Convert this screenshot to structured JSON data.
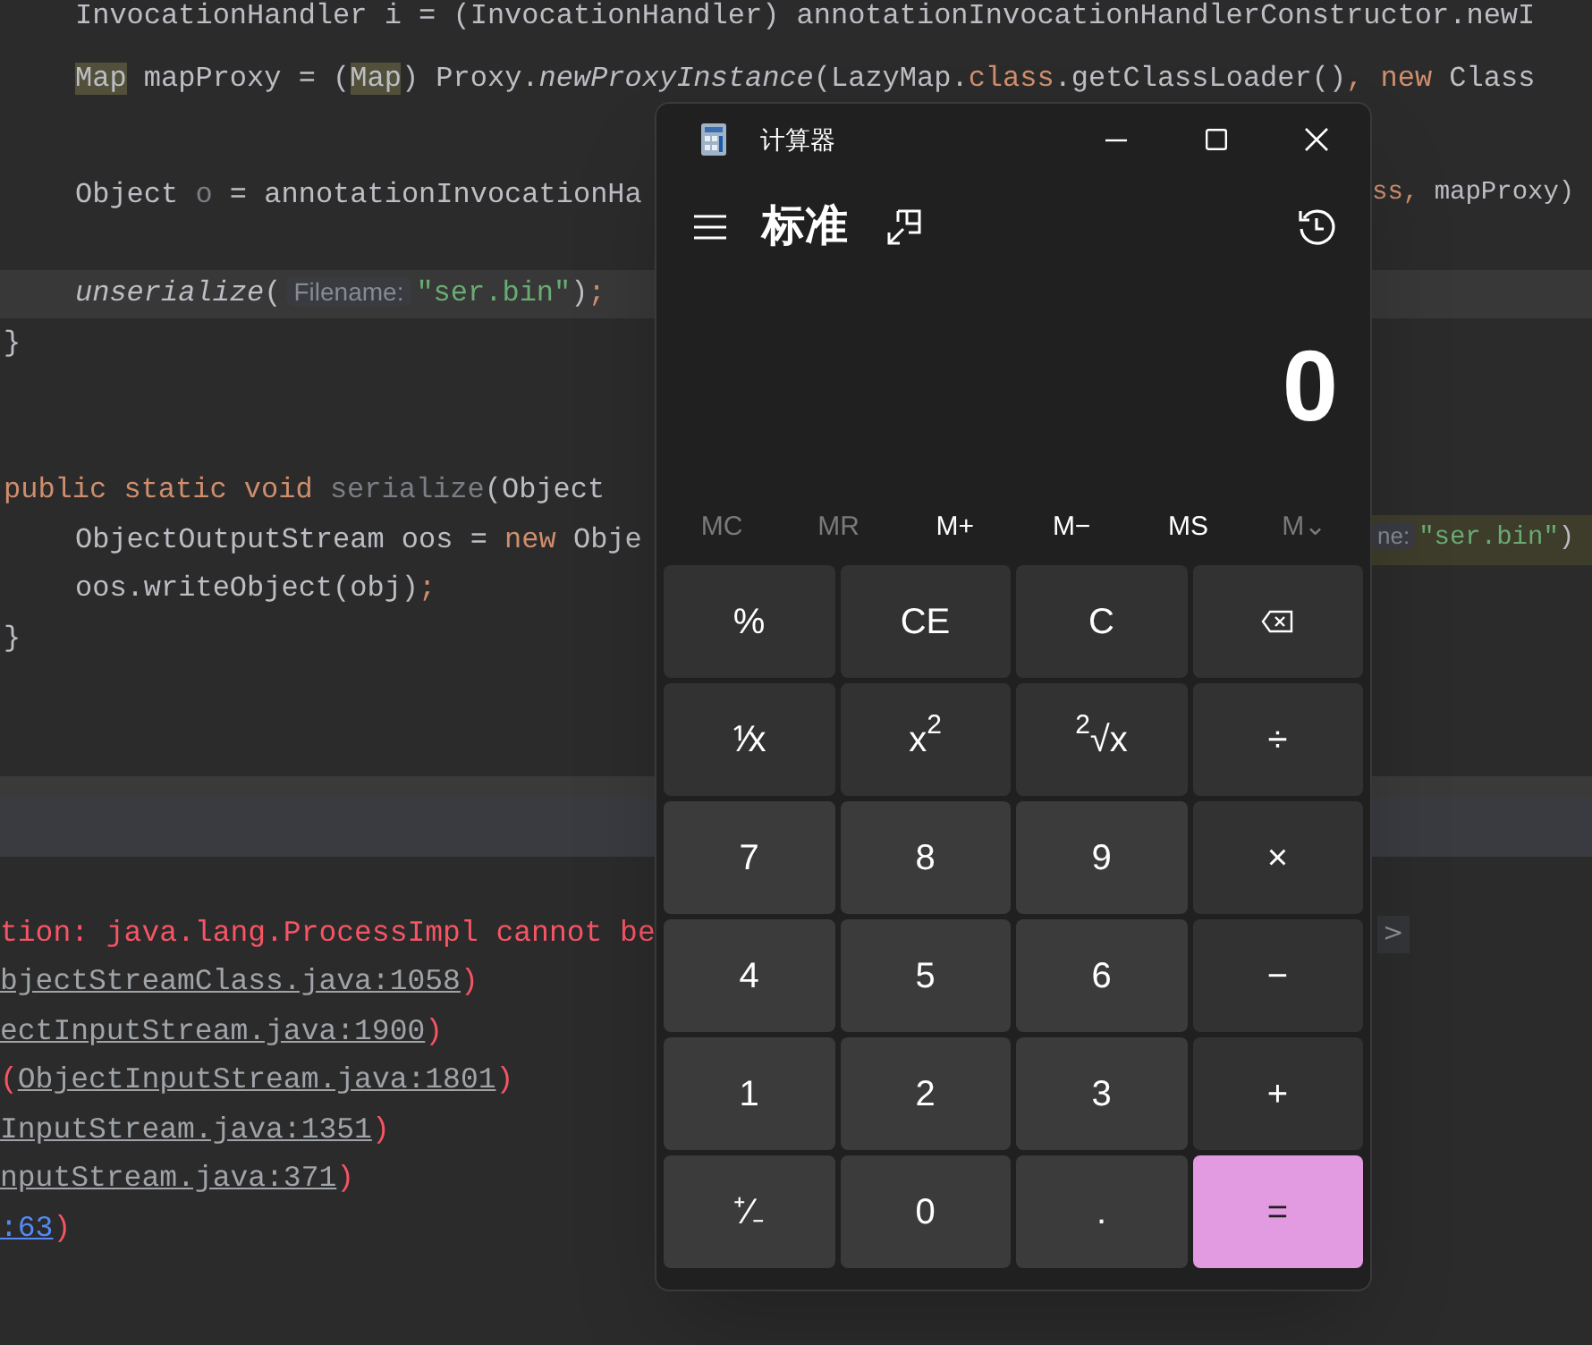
{
  "editor": {
    "lines": [
      {
        "kind": "indented",
        "current": false,
        "left": [
          {
            "text": "InvocationHandler i = (InvocationHandler) annotationInvocationHandlerConstructor.newI",
            "kind": "plain"
          }
        ]
      },
      {
        "kind": "blank",
        "current": false
      },
      {
        "kind": "indented",
        "current": false,
        "left": [
          {
            "text": "Map",
            "kind": "mark"
          },
          {
            "text": " mapProxy = (",
            "kind": "plain"
          },
          {
            "text": "Map",
            "kind": "mark"
          },
          {
            "text": ") Proxy.",
            "kind": "plain"
          },
          {
            "text": "newProxyInstance",
            "kind": "italic"
          },
          {
            "text": "(LazyMap.",
            "kind": "plain"
          },
          {
            "text": "class",
            "kind": "keyword"
          },
          {
            "text": ".getClassLoader()",
            "kind": "plain"
          },
          {
            "text": ", ",
            "kind": "keyword"
          },
          {
            "text": "new",
            "kind": "keyword"
          },
          {
            "text": " Class",
            "kind": "plain"
          }
        ]
      },
      {
        "kind": "blank",
        "current": false
      },
      {
        "kind": "indented",
        "current": false,
        "left": [
          {
            "text": "Object ",
            "kind": "plain"
          },
          {
            "text": "o",
            "kind": "unused"
          },
          {
            "text": " = annotationInvocationHa",
            "kind": "plain"
          }
        ],
        "right": [
          {
            "text": "ss",
            "kind": "keyword"
          },
          {
            "text": ", ",
            "kind": "keyword"
          },
          {
            "text": "mapProxy)",
            "kind": "plain"
          }
        ]
      },
      {
        "kind": "blank",
        "current": false
      },
      {
        "kind": "indented",
        "current": true,
        "left": [
          {
            "text": "unserialize",
            "kind": "italic"
          },
          {
            "text": "(",
            "kind": "plain"
          },
          {
            "text": "Filename:",
            "kind": "hint"
          },
          {
            "text": "\"ser.bin\"",
            "kind": "string"
          },
          {
            "text": ")",
            "kind": "plain"
          },
          {
            "text": ";",
            "kind": "keyword"
          }
        ]
      },
      {
        "kind": "outer",
        "current": false,
        "left": [
          {
            "text": "}",
            "kind": "plain"
          }
        ]
      },
      {
        "kind": "blank",
        "current": false
      },
      {
        "kind": "blank",
        "current": false
      },
      {
        "kind": "outer",
        "current": false,
        "left": [
          {
            "text": "public static void ",
            "kind": "keyword"
          },
          {
            "text": "serialize",
            "kind": "unused"
          },
          {
            "text": "(Object",
            "kind": "plain"
          }
        ]
      },
      {
        "kind": "indented",
        "current": false,
        "left": [
          {
            "text": "ObjectOutputStream oos = ",
            "kind": "plain"
          },
          {
            "text": "new",
            "kind": "keyword"
          },
          {
            "text": " Obje",
            "kind": "plain"
          }
        ],
        "right_highlighted": true,
        "right": [
          {
            "text": "ne:",
            "kind": "hint"
          },
          {
            "text": "\"ser.bin\"",
            "kind": "string"
          },
          {
            "text": ")",
            "kind": "plain"
          }
        ]
      },
      {
        "kind": "indented",
        "current": false,
        "left": [
          {
            "text": "oos.writeObject(obj)",
            "kind": "plain"
          },
          {
            "text": ";",
            "kind": "keyword"
          }
        ]
      },
      {
        "kind": "outer",
        "current": false,
        "left": [
          {
            "text": "}",
            "kind": "plain"
          }
        ]
      }
    ]
  },
  "console": {
    "lines": [
      [
        {
          "text": "tion: java.lang.ProcessImpl cannot be",
          "kind": "error"
        }
      ],
      [
        {
          "text": "bjectStreamClass.java:1058",
          "kind": "link"
        },
        {
          "text": ")",
          "kind": "error"
        }
      ],
      [
        {
          "text": "ectInputStream.java:1900",
          "kind": "link"
        },
        {
          "text": ")",
          "kind": "error"
        }
      ],
      [
        {
          "text": "(",
          "kind": "error"
        },
        {
          "text": "ObjectInputStream.java:1801",
          "kind": "link"
        },
        {
          "text": ")",
          "kind": "error"
        }
      ],
      [
        {
          "text": "InputStream.java:1351",
          "kind": "link"
        },
        {
          "text": ")",
          "kind": "error"
        }
      ],
      [
        {
          "text": "nputStream.java:371",
          "kind": "link"
        },
        {
          "text": ")",
          "kind": "error"
        }
      ],
      [
        {
          "text": ":63",
          "kind": "source_link"
        },
        {
          "text": ")",
          "kind": "error"
        }
      ]
    ],
    "expand_button": ">"
  },
  "calculator": {
    "window": {
      "title": "计算器"
    },
    "mode": "标准",
    "display": "0",
    "memory": [
      {
        "label": "MC",
        "disabled": true
      },
      {
        "label": "MR",
        "disabled": true
      },
      {
        "label": "M+",
        "disabled": false
      },
      {
        "label": "M−",
        "disabled": false
      },
      {
        "label": "MS",
        "disabled": false
      },
      {
        "label": "M⌄",
        "disabled": true
      }
    ],
    "keys": [
      {
        "label": "%",
        "kind": "op"
      },
      {
        "label": "CE",
        "kind": "op"
      },
      {
        "label": "C",
        "kind": "op"
      },
      {
        "kind": "backspace"
      },
      {
        "label": "⅟x",
        "kind": "op"
      },
      {
        "label": "x$^{2}$",
        "kind": "op"
      },
      {
        "label": "$^{2}$√x",
        "kind": "op"
      },
      {
        "label": "÷",
        "kind": "op"
      },
      {
        "label": "7",
        "kind": "digit"
      },
      {
        "label": "8",
        "kind": "digit"
      },
      {
        "label": "9",
        "kind": "digit"
      },
      {
        "label": "×",
        "kind": "op"
      },
      {
        "label": "4",
        "kind": "digit"
      },
      {
        "label": "5",
        "kind": "digit"
      },
      {
        "label": "6",
        "kind": "digit"
      },
      {
        "label": "−",
        "kind": "op"
      },
      {
        "label": "1",
        "kind": "digit"
      },
      {
        "label": "2",
        "kind": "digit"
      },
      {
        "label": "3",
        "kind": "digit"
      },
      {
        "label": "+",
        "kind": "op"
      },
      {
        "label": "⁺∕₋",
        "kind": "digit"
      },
      {
        "label": "0",
        "kind": "digit"
      },
      {
        "label": ".",
        "kind": "digit"
      },
      {
        "label": "=",
        "kind": "equals"
      }
    ]
  }
}
